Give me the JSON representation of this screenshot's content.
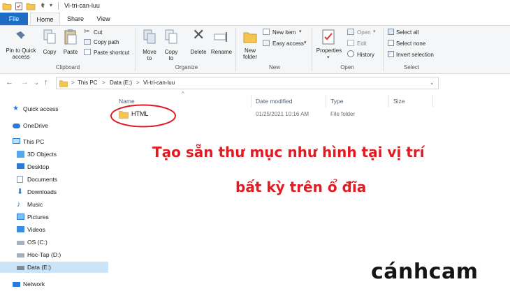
{
  "window": {
    "title": "Vi-tri-can-luu"
  },
  "tabs": [
    {
      "label": "File"
    },
    {
      "label": "Home"
    },
    {
      "label": "Share"
    },
    {
      "label": "View"
    }
  ],
  "ribbon": {
    "clipboard": {
      "group_label": "Clipboard",
      "pin_label": "Pin to Quick access",
      "copy_label": "Copy",
      "paste_label": "Paste",
      "cut_label": "Cut",
      "copy_path_label": "Copy path",
      "paste_shortcut_label": "Paste shortcut"
    },
    "organize": {
      "group_label": "Organize",
      "move_to_label": "Move to",
      "copy_to_label": "Copy to",
      "delete_label": "Delete",
      "rename_label": "Rename"
    },
    "new": {
      "group_label": "New",
      "new_folder_label": "New folder",
      "new_item_label": "New item",
      "easy_access_label": "Easy access"
    },
    "open": {
      "group_label": "Open",
      "properties_label": "Properties",
      "open_label": "Open",
      "edit_label": "Edit",
      "history_label": "History"
    },
    "select": {
      "group_label": "Select",
      "select_all_label": "Select all",
      "select_none_label": "Select none",
      "invert_selection_label": "Invert selection"
    }
  },
  "address": {
    "crumbs": [
      "This PC",
      "Data (E:)",
      "Vi-tri-can-luu"
    ],
    "separator": ">"
  },
  "nav_pane": {
    "quick_access": "Quick access",
    "onedrive": "OneDrive",
    "this_pc": "This PC",
    "items": [
      {
        "label": "3D Objects",
        "icon": "cube-icon"
      },
      {
        "label": "Desktop",
        "icon": "desktop-icon"
      },
      {
        "label": "Documents",
        "icon": "documents-icon"
      },
      {
        "label": "Downloads",
        "icon": "downloads-icon"
      },
      {
        "label": "Music",
        "icon": "music-icon"
      },
      {
        "label": "Pictures",
        "icon": "pictures-icon"
      },
      {
        "label": "Videos",
        "icon": "videos-icon"
      },
      {
        "label": "OS (C:)",
        "icon": "drive-icon"
      },
      {
        "label": "Hoc-Tap (D:)",
        "icon": "drive-icon"
      },
      {
        "label": "Data (E:)",
        "icon": "drive-icon"
      }
    ],
    "network": "Network"
  },
  "file_list": {
    "columns": {
      "name": "Name",
      "date": "Date modified",
      "type": "Type",
      "size": "Size"
    },
    "rows": [
      {
        "name": "HTML",
        "date": "01/25/2021 10:16 AM",
        "type": "File folder",
        "size": ""
      }
    ]
  },
  "overlay": {
    "line1": "Tạo sẵn thư mục như hình tại vị trí",
    "line2": "bất kỳ trên ổ đĩa"
  },
  "brand": {
    "text": "cánhcam"
  },
  "colors": {
    "accent": "#1e6cc4",
    "highlight": "#e11b22",
    "selection": "#cce4f7",
    "folder": "#f5c451"
  }
}
